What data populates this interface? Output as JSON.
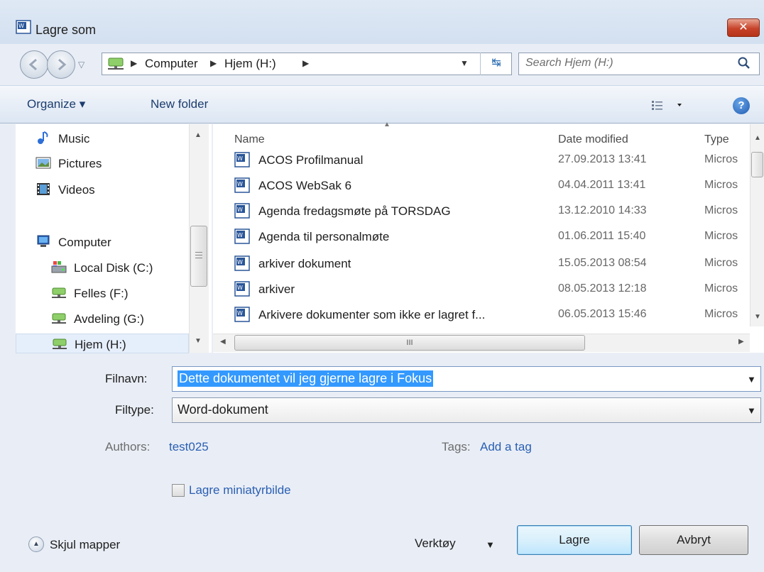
{
  "window": {
    "title": "Lagre som",
    "close_label": "✕"
  },
  "address": {
    "crumbs": [
      "Computer",
      "Hjem (H:)"
    ],
    "search_placeholder": "Search Hjem (H:)"
  },
  "toolbar": {
    "organize_label": "Organize ▾",
    "new_folder_label": "New folder",
    "help_label": "?"
  },
  "nav": {
    "items": [
      {
        "label": "Music",
        "icon": "music-icon"
      },
      {
        "label": "Pictures",
        "icon": "pictures-icon"
      },
      {
        "label": "Videos",
        "icon": "videos-icon"
      },
      {
        "label": "Computer",
        "icon": "computer-icon"
      },
      {
        "label": "Local Disk (C:)",
        "icon": "local-disk-icon"
      },
      {
        "label": "Felles (F:)",
        "icon": "network-drive-icon"
      },
      {
        "label": "Avdeling (G:)",
        "icon": "network-drive-icon"
      },
      {
        "label": "Hjem (H:)",
        "icon": "network-drive-icon"
      }
    ]
  },
  "files": {
    "columns": {
      "name": "Name",
      "date": "Date modified",
      "type": "Type"
    },
    "rows": [
      {
        "name": "ACOS Profilmanual",
        "date": "27.09.2013 13:41",
        "type": "Micros"
      },
      {
        "name": "ACOS WebSak 6",
        "date": "04.04.2011 13:41",
        "type": "Micros"
      },
      {
        "name": "Agenda fredagsmøte på TORSDAG",
        "date": "13.12.2010 14:33",
        "type": "Micros"
      },
      {
        "name": "Agenda til personalmøte",
        "date": "01.06.2011 15:40",
        "type": "Micros"
      },
      {
        "name": "arkiver dokument",
        "date": "15.05.2013 08:54",
        "type": "Micros"
      },
      {
        "name": "arkiver",
        "date": "08.05.2013 12:18",
        "type": "Micros"
      },
      {
        "name": "Arkivere dokumenter som ikke er lagret f...",
        "date": "06.05.2013 15:46",
        "type": "Micros"
      }
    ],
    "hscroll_grip": "III"
  },
  "form": {
    "filename_label": "Filnavn:",
    "filename_value": "Dette dokumentet vil jeg gjerne lagre i Fokus",
    "filetype_label": "Filtype:",
    "filetype_value": "Word-dokument",
    "authors_label": "Authors:",
    "authors_value": "test025",
    "tags_label": "Tags:",
    "tags_value": "Add a tag",
    "thumbnail_label": "Lagre miniatyrbilde"
  },
  "footer": {
    "hide_folders_label": "Skjul mapper",
    "tools_label": "Verktøy",
    "save_label": "Lagre",
    "cancel_label": "Avbryt"
  }
}
